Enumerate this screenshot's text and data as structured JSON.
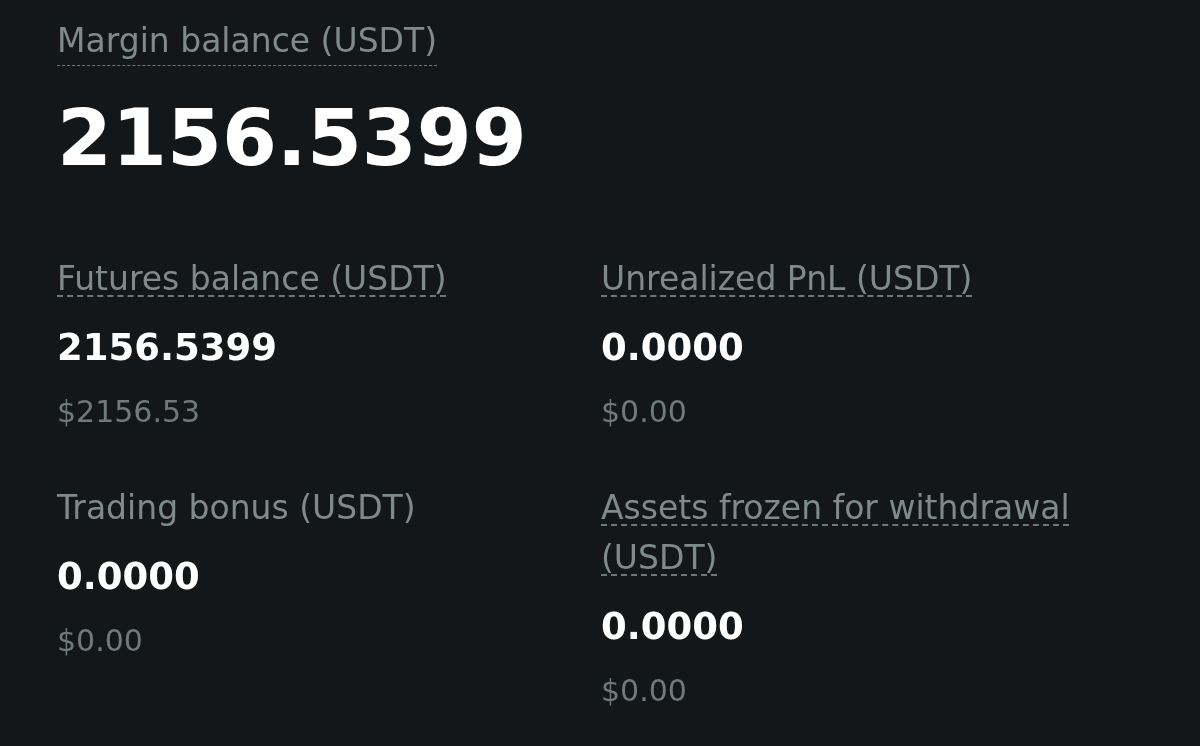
{
  "margin_balance": {
    "label": "Margin balance (USDT)",
    "hint": true,
    "value": "2156.5399"
  },
  "balances": [
    {
      "label": "Futures balance (USDT)",
      "hint": true,
      "value": "2156.5399",
      "fiat": "$2156.53"
    },
    {
      "label": "Unrealized PnL (USDT)",
      "hint": true,
      "value": "0.0000",
      "fiat": "$0.00"
    },
    {
      "label": "Trading bonus (USDT)",
      "hint": false,
      "value": "0.0000",
      "fiat": "$0.00"
    },
    {
      "label": "Assets frozen for withdrawal (USDT)",
      "hint": true,
      "value": "0.0000",
      "fiat": "$0.00"
    }
  ]
}
